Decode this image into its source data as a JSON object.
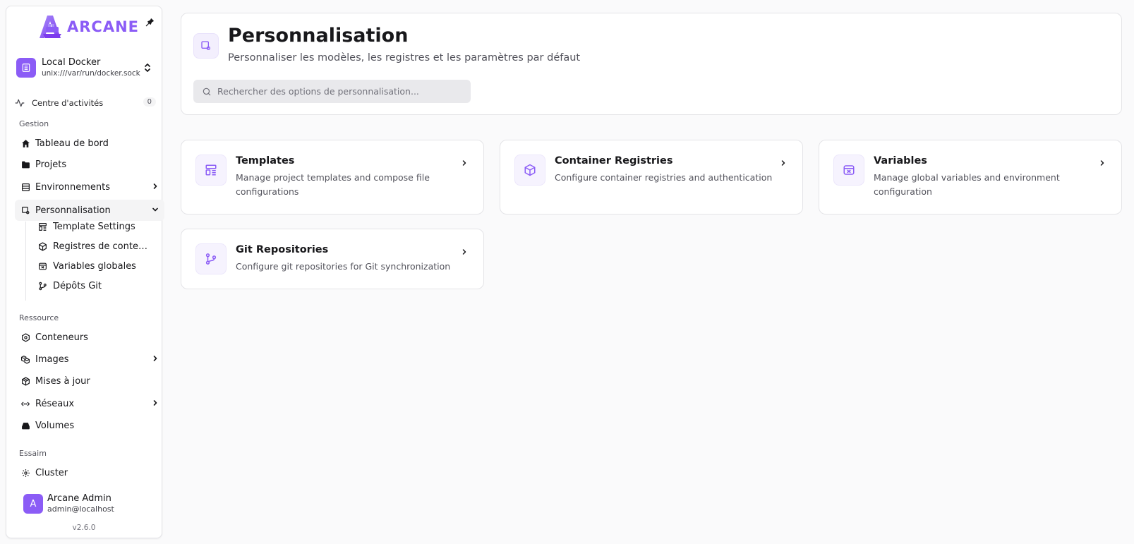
{
  "brand": {
    "name": "ARCANE",
    "accent": "#8b5cf6"
  },
  "environment": {
    "name": "Local Docker",
    "socket": "unix:///var/run/docker.sock"
  },
  "activity": {
    "label": "Centre d'activités",
    "count": "0"
  },
  "sidebar": {
    "sections": {
      "gestion": "Gestion",
      "ressource": "Ressource",
      "essaim": "Essaim"
    },
    "gestion_items": [
      {
        "label": "Tableau de bord",
        "icon": "home-icon"
      },
      {
        "label": "Projets",
        "icon": "folder-icon"
      },
      {
        "label": "Environnements",
        "icon": "server-icon"
      },
      {
        "label": "Personnalisation",
        "icon": "customize-icon"
      }
    ],
    "personnalisation_sub": [
      {
        "label": "Template Settings",
        "icon": "template-icon"
      },
      {
        "label": "Registres de conteneurs",
        "icon": "registry-icon"
      },
      {
        "label": "Variables globales",
        "icon": "variables-icon"
      },
      {
        "label": "Dépôts Git",
        "icon": "git-icon"
      }
    ],
    "ressource_items": [
      {
        "label": "Conteneurs",
        "icon": "container-icon"
      },
      {
        "label": "Images",
        "icon": "images-icon"
      },
      {
        "label": "Mises à jour",
        "icon": "package-icon"
      },
      {
        "label": "Réseaux",
        "icon": "network-icon"
      },
      {
        "label": "Volumes",
        "icon": "drive-icon"
      }
    ],
    "essaim_items": [
      {
        "label": "Cluster",
        "icon": "cluster-icon"
      }
    ]
  },
  "user": {
    "initial": "A",
    "name": "Arcane Admin",
    "email": "admin@localhost"
  },
  "version": "v2.6.0",
  "page": {
    "title": "Personnalisation",
    "subtitle": "Personnaliser les modèles, les registres et les paramètres par défaut",
    "search_placeholder": "Rechercher des options de personnalisation..."
  },
  "cards": [
    {
      "title": "Templates",
      "description": "Manage project templates and compose file configurations",
      "icon": "template-icon"
    },
    {
      "title": "Container Registries",
      "description": "Configure container registries and authentication",
      "icon": "registry-icon"
    },
    {
      "title": "Variables",
      "description": "Manage global variables and environment configuration",
      "icon": "variables-icon"
    },
    {
      "title": "Git Repositories",
      "description": "Configure git repositories for Git synchronization",
      "icon": "git-icon"
    }
  ]
}
